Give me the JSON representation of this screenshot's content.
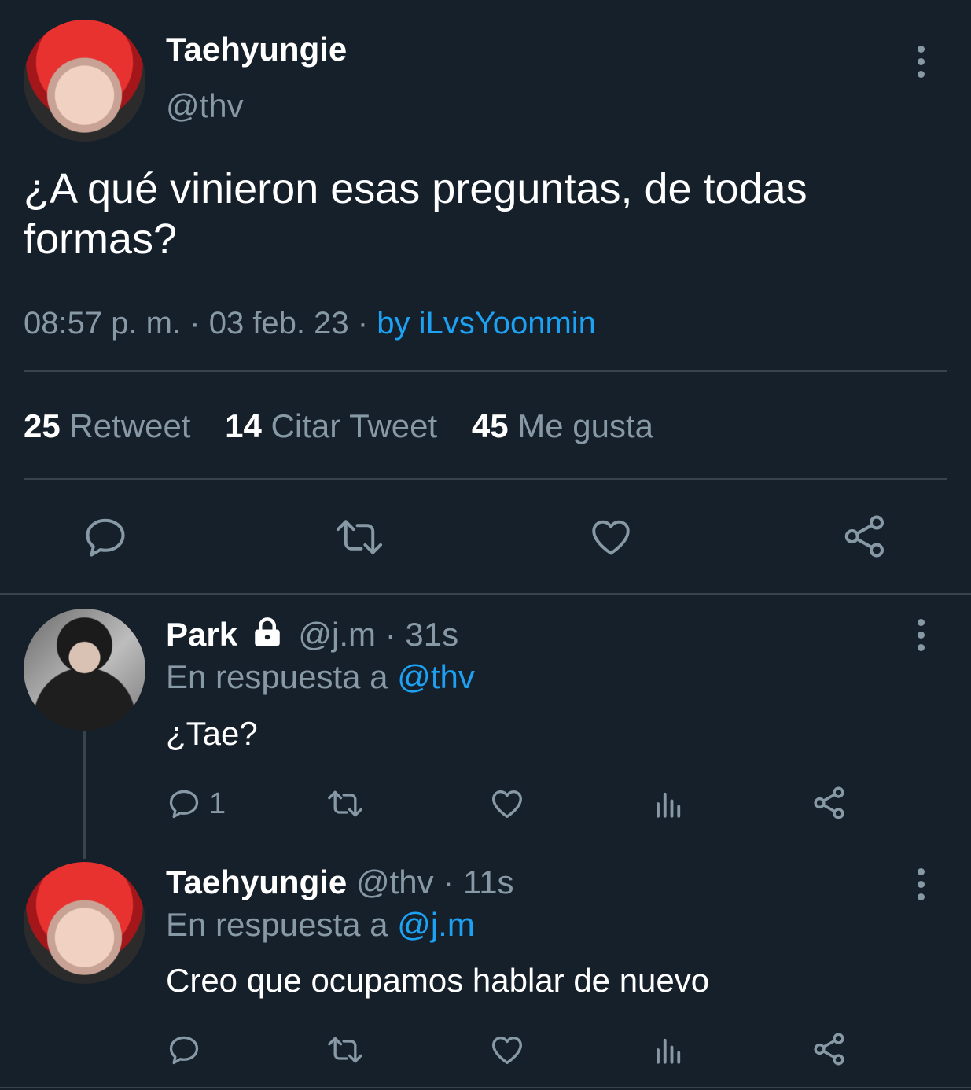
{
  "main_tweet": {
    "display_name": "Taehyungie",
    "handle": "@thv",
    "text": "¿A qué vinieron esas preguntas, de todas formas?",
    "time": "08:57 p. m.",
    "sep1": "·",
    "date": "03 feb. 23",
    "sep2": "·",
    "source": "by iLvsYoonmin",
    "stats": {
      "retweets_count": "25",
      "retweets_label": "Retweet",
      "quotes_count": "14",
      "quotes_label": "Citar Tweet",
      "likes_count": "45",
      "likes_label": "Me gusta"
    },
    "action_icons": [
      "reply-icon",
      "retweet-icon",
      "like-icon",
      "share-icon"
    ]
  },
  "replies": [
    {
      "display_name": "Park",
      "locked": true,
      "handle": "@j.m",
      "sep": "·",
      "time": "31s",
      "reply_prefix": "En respuesta a",
      "reply_to": "@thv",
      "text": "¿Tae?",
      "reply_count": "1"
    },
    {
      "display_name": "Taehyungie",
      "handle": "@thv",
      "sep": "·",
      "time": "11s",
      "reply_prefix": "En respuesta a",
      "reply_to": "@j.m",
      "text": "Creo que ocupamos hablar de nuevo",
      "reply_count": ""
    }
  ],
  "colors": {
    "background": "#15202b",
    "muted": "#8899a6",
    "accent": "#1da1f2",
    "divider": "#38444d"
  }
}
